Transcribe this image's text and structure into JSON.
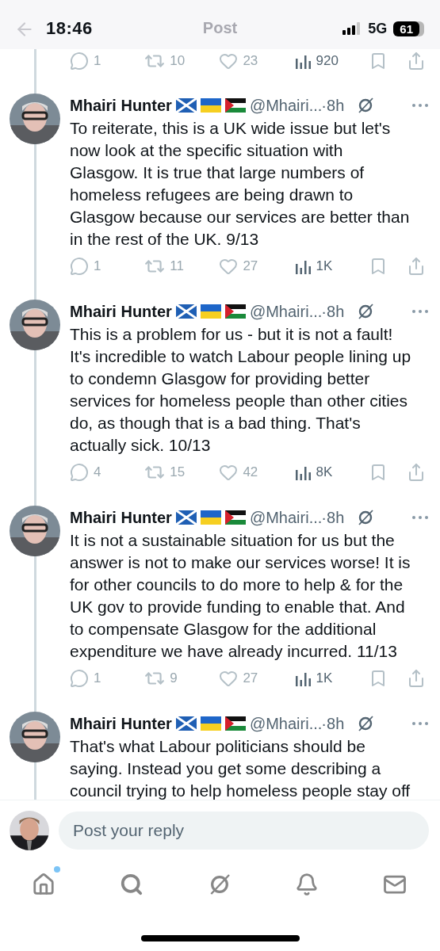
{
  "status_bar": {
    "time": "18:46",
    "network": "5G",
    "battery": "61"
  },
  "header": {
    "title": "Post"
  },
  "previous_actions": {
    "replies": "1",
    "reposts": "10",
    "likes": "23",
    "views": "920"
  },
  "posts": [
    {
      "name": "Mhairi Hunter",
      "handle": "@Mhairi...",
      "time": "·8h",
      "text": "To reiterate, this is a UK wide issue but let's now look at the specific situation with Glasgow. It is true that large numbers of homeless refugees are being drawn to Glasgow because our services are better than in the rest of the UK. 9/13",
      "replies": "1",
      "reposts": "11",
      "likes": "27",
      "views": "1K"
    },
    {
      "name": "Mhairi Hunter",
      "handle": "@Mhairi...",
      "time": "·8h",
      "text": "This is a problem for us - but it is not a fault! It's incredible to watch Labour people lining up to condemn Glasgow for providing better services for homeless people than other cities do, as though that is a bad thing. That's actually sick. 10/13",
      "replies": "4",
      "reposts": "15",
      "likes": "42",
      "views": "8K"
    },
    {
      "name": "Mhairi Hunter",
      "handle": "@Mhairi...",
      "time": "·8h",
      "text": "It is not a sustainable situation for us but the answer is not to make our services worse! It is for other councils to do more to help & for the UK gov to provide funding to enable that. And to compensate Glasgow for the additional expenditure we have already incurred. 11/13",
      "replies": "1",
      "reposts": "9",
      "likes": "27",
      "views": "1K"
    },
    {
      "name": "Mhairi Hunter",
      "handle": "@Mhairi...",
      "time": "·8h",
      "text": "That's what Labour politicians should be saying. Instead you get some describing a council trying to help homeless people stay off"
    }
  ],
  "reply_bar": {
    "placeholder": "Post your reply"
  },
  "nav": [
    {
      "kind": "home",
      "unread": true
    },
    {
      "kind": "search",
      "unread": false
    },
    {
      "kind": "grok",
      "unread": false
    },
    {
      "kind": "notifications",
      "unread": false
    },
    {
      "kind": "messages",
      "unread": false
    }
  ]
}
